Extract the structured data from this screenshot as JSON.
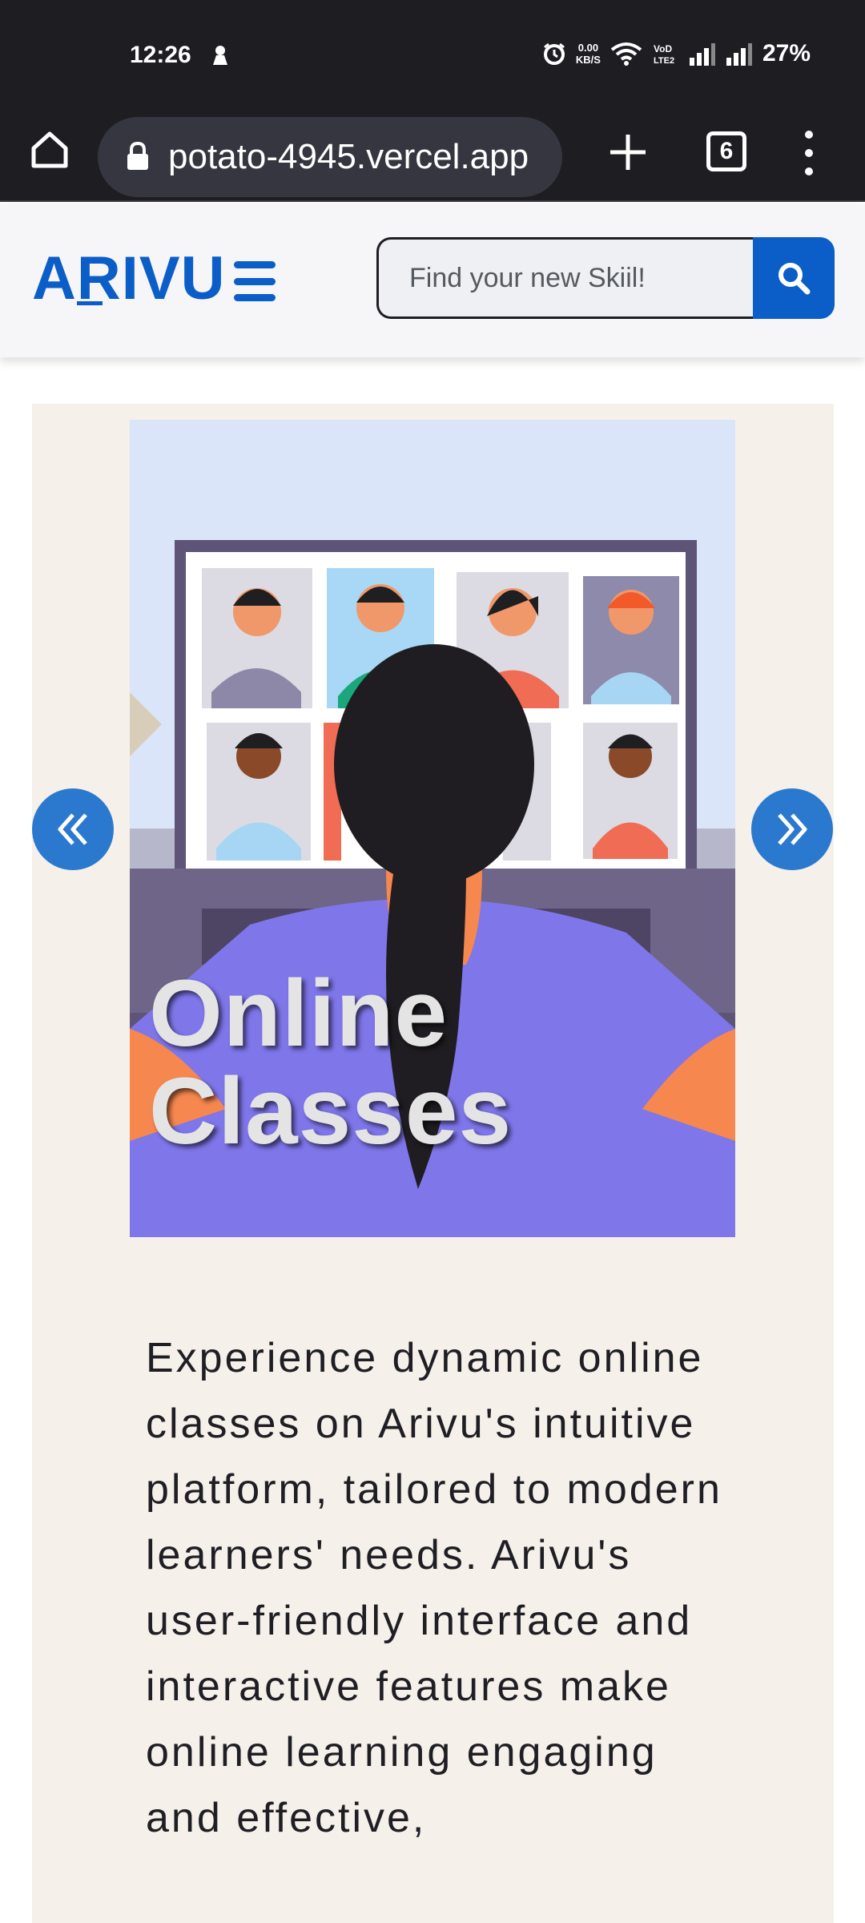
{
  "status_bar": {
    "time": "12:26",
    "net_speed_value": "0.00",
    "net_speed_unit": "KB/S",
    "battery": "27%",
    "icons": [
      "notification-icon",
      "alarm-icon",
      "wifi-icon",
      "volte-icon",
      "signal-icon",
      "signal-icon",
      "battery-text"
    ]
  },
  "browser": {
    "url": "potato-4945.vercel.app",
    "tab_count": "6",
    "icons": [
      "home-icon",
      "lock-icon",
      "plus-icon",
      "tabs-icon",
      "more-vertical-icon"
    ]
  },
  "header": {
    "logo": "ARIVU",
    "search_placeholder": "Find your new Skiil!",
    "icons": [
      "hamburger-menu-icon",
      "search-icon"
    ],
    "colors": {
      "brand": "#0b5dc8"
    }
  },
  "carousel": {
    "slide_title_line1": "Online",
    "slide_title_line2": "Classes",
    "description": "Experience dynamic online classes on Arivu's intuitive platform, tailored to modern learners' needs. Arivu's user-friendly interface and interactive features make online learning engaging and effective,",
    "icons": [
      "chevrons-left-icon",
      "chevrons-right-icon"
    ],
    "colors": {
      "card_bg": "#f5f0e9",
      "arrow": "#2b79cf"
    }
  }
}
